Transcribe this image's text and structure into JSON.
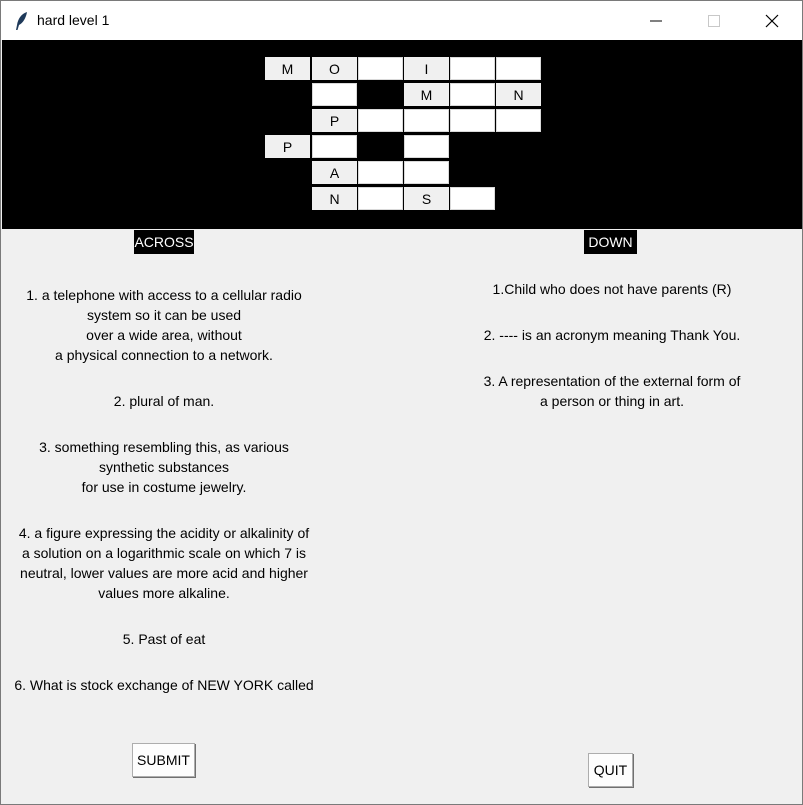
{
  "window": {
    "title": "hard level 1"
  },
  "grid": {
    "cells": [
      {
        "row": 0,
        "col": 0,
        "letter": "M",
        "given": true
      },
      {
        "row": 0,
        "col": 1,
        "letter": "O",
        "given": true
      },
      {
        "row": 0,
        "col": 2,
        "letter": "",
        "given": false
      },
      {
        "row": 0,
        "col": 3,
        "letter": "I",
        "given": true
      },
      {
        "row": 0,
        "col": 4,
        "letter": "",
        "given": false
      },
      {
        "row": 0,
        "col": 5,
        "letter": "",
        "given": false
      },
      {
        "row": 1,
        "col": 1,
        "letter": "",
        "given": false
      },
      {
        "row": 1,
        "col": 3,
        "letter": "M",
        "given": true
      },
      {
        "row": 1,
        "col": 4,
        "letter": "",
        "given": false
      },
      {
        "row": 1,
        "col": 5,
        "letter": "N",
        "given": true
      },
      {
        "row": 2,
        "col": 1,
        "letter": "P",
        "given": true
      },
      {
        "row": 2,
        "col": 2,
        "letter": "",
        "given": false
      },
      {
        "row": 2,
        "col": 3,
        "letter": "",
        "given": false
      },
      {
        "row": 2,
        "col": 4,
        "letter": "",
        "given": false
      },
      {
        "row": 2,
        "col": 5,
        "letter": "",
        "given": false
      },
      {
        "row": 3,
        "col": 0,
        "letter": "P",
        "given": true
      },
      {
        "row": 3,
        "col": 1,
        "letter": "",
        "given": false
      },
      {
        "row": 3,
        "col": 3,
        "letter": "",
        "given": false
      },
      {
        "row": 4,
        "col": 1,
        "letter": "A",
        "given": true
      },
      {
        "row": 4,
        "col": 2,
        "letter": "",
        "given": false
      },
      {
        "row": 4,
        "col": 3,
        "letter": "",
        "given": false
      },
      {
        "row": 5,
        "col": 1,
        "letter": "N",
        "given": true
      },
      {
        "row": 5,
        "col": 2,
        "letter": "",
        "given": false
      },
      {
        "row": 5,
        "col": 3,
        "letter": "S",
        "given": true
      },
      {
        "row": 5,
        "col": 4,
        "letter": "",
        "given": false
      }
    ]
  },
  "across": {
    "label": "ACROSS",
    "clues": [
      [
        "1.  a telephone with access to a cellular radio",
        "system so it can be used",
        "over a wide area, without",
        "a physical connection to a network."
      ],
      [
        "2. plural of man."
      ],
      [
        "3.  something resembling this, as various",
        "synthetic substances",
        "for use in costume jewelry."
      ],
      [
        "4.  a figure expressing the acidity or alkalinity of",
        "a solution on a logarithmic scale on which 7 is",
        "neutral, lower values are more acid and higher",
        "values more alkaline."
      ],
      [
        "5. Past of eat"
      ],
      [
        "6. What is stock exchange of NEW YORK called"
      ]
    ]
  },
  "down": {
    "label": "DOWN",
    "clues": [
      [
        "1.Child who does not have parents  (R)"
      ],
      [
        "2. ---- is an acronym meaning Thank You."
      ],
      [
        "3. A representation of the external form of",
        "a person or thing in art."
      ]
    ]
  },
  "buttons": {
    "submit": "SUBMIT",
    "quit": "QUIT"
  }
}
